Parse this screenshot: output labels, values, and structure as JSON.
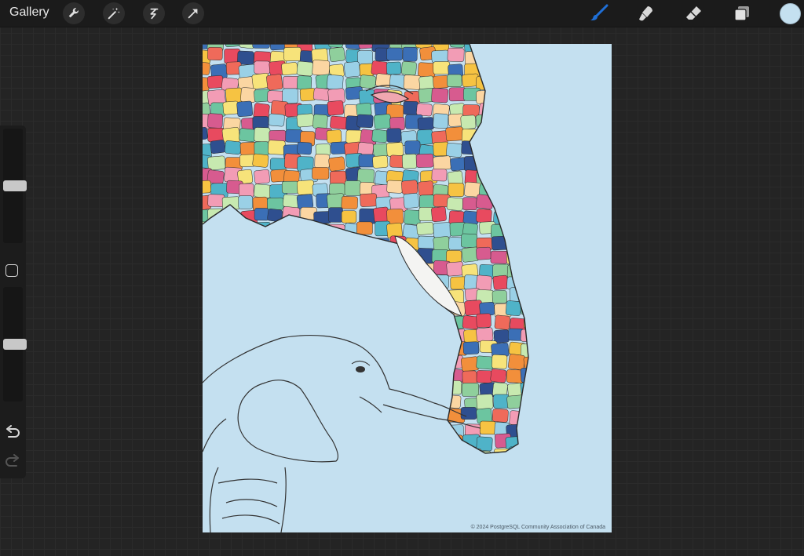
{
  "toolbar": {
    "gallery_label": "Gallery",
    "left_tools": [
      "wrench-icon",
      "magic-wand-icon",
      "selection-icon",
      "transform-arrow-icon"
    ],
    "right_tools": [
      "brush-icon",
      "smudge-icon",
      "eraser-icon",
      "layers-icon"
    ],
    "active_tool": "brush-icon",
    "active_color": "#c4e0f0",
    "accent": "#1f6fd6"
  },
  "sidebar": {
    "brush_size_level": 0.5,
    "opacity_level": 0.5
  },
  "canvas": {
    "background_color": "#c4e0f0",
    "copyright": "© 2024 PostgreSQL Community Association of Canada"
  }
}
